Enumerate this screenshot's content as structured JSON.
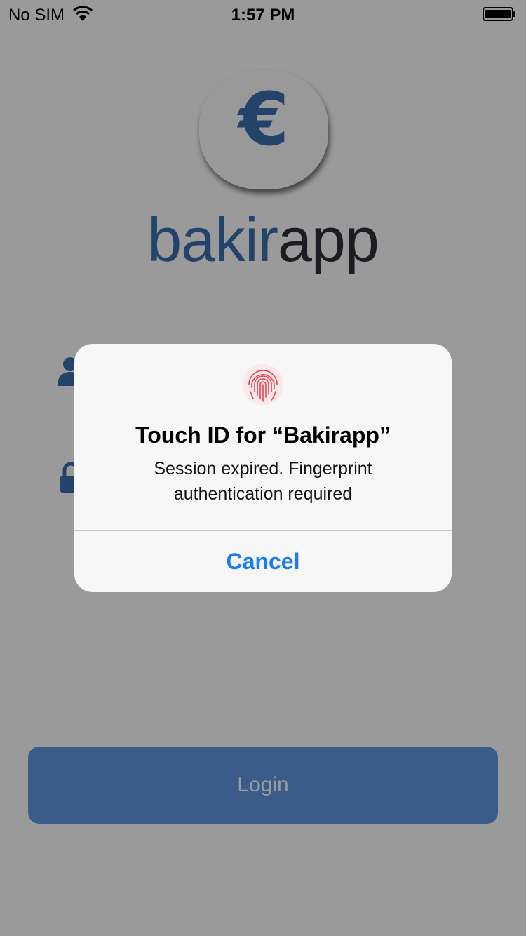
{
  "status_bar": {
    "carrier": "No SIM",
    "time": "1:57 PM",
    "icons": [
      "wifi-icon",
      "battery-icon"
    ]
  },
  "app": {
    "logo_symbol": "€",
    "brand_part1": "bakir",
    "brand_part2": "app",
    "colors": {
      "brand_blue": "#3a6aa8",
      "brand_dark": "#2b2f36",
      "button_blue": "#5b93d8"
    }
  },
  "form": {
    "icons": [
      "user-icon",
      "lock-icon"
    ],
    "login_label": "Login"
  },
  "touch_id_alert": {
    "icon": "fingerprint-icon",
    "title": "Touch ID for “Bakirapp”",
    "message": "Session expired. Fingerprint authentication required",
    "cancel_label": "Cancel",
    "colors": {
      "fingerprint": "#e8404a",
      "cancel": "#1a7cf5"
    }
  }
}
